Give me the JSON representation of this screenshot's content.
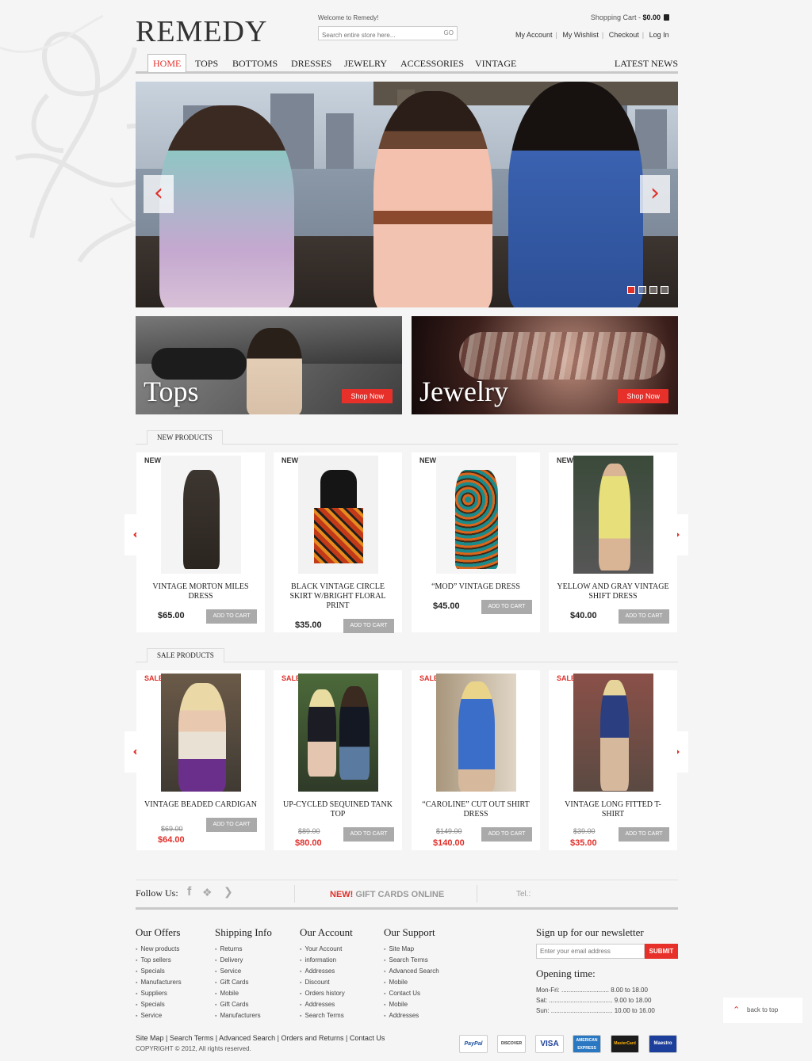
{
  "header": {
    "logo": "REMEDY",
    "welcome": "Welcome to Remedy!",
    "search_placeholder": "Search entire store here...",
    "search_go": "GO",
    "cart_label": "Shopping Cart",
    "cart_sep": " - ",
    "cart_total": "$0.00",
    "links": [
      "My Account",
      "My Wishlist",
      "Checkout",
      "Log In"
    ]
  },
  "nav": {
    "items": [
      "HOME",
      "TOPS",
      "BOTTOMS",
      "DRESSES",
      "JEWELRY",
      "ACCESSORIES",
      "VINTAGE"
    ],
    "right": "LATEST NEWS"
  },
  "hero": {
    "prev": "‹",
    "next": "›",
    "slides": 4,
    "active_slide": 1
  },
  "banners": [
    {
      "title": "Tops",
      "button": "Shop Now"
    },
    {
      "title": "Jewelry",
      "button": "Shop Now"
    }
  ],
  "new_products": {
    "heading": "NEW PRODUCTS",
    "badge": "NEW",
    "add_label": "ADD TO CART",
    "items": [
      {
        "name": "VINTAGE MORTON MILES DRESS",
        "price": "$65.00"
      },
      {
        "name": "BLACK VINTAGE CIRCLE SKIRT W/BRIGHT FLORAL PRINT",
        "price": "$35.00"
      },
      {
        "name": "“MOD” VINTAGE DRESS",
        "price": "$45.00"
      },
      {
        "name": "YELLOW AND GRAY VINTAGE SHIFT DRESS",
        "price": "$40.00"
      }
    ]
  },
  "sale_products": {
    "heading": "SALE PRODUCTS",
    "badge": "SALE",
    "add_label": "ADD TO CART",
    "items": [
      {
        "name": "VINTAGE BEADED CARDIGAN",
        "old_price": "$69.00",
        "price": "$64.00"
      },
      {
        "name": "UP-CYCLED SEQUINED TANK TOP",
        "old_price": "$89.00",
        "price": "$80.00"
      },
      {
        "name": "“CAROLINE” CUT OUT SHIRT DRESS",
        "old_price": "$149.00",
        "price": "$140.00"
      },
      {
        "name": "VINTAGE LONG FITTED T-SHIRT",
        "old_price": "$39.00",
        "price": "$35.00"
      }
    ]
  },
  "follow": {
    "label": "Follow Us:",
    "gift_new": "NEW!",
    "gift_text": " GIFT CARDS ONLINE",
    "tel": "Tel.:"
  },
  "footer": {
    "columns": [
      {
        "title": "Our Offers",
        "items": [
          "New products",
          "Top sellers",
          "Specials",
          "Manufacturers",
          "Suppliers",
          "Specials",
          "Service"
        ]
      },
      {
        "title": "Shipping Info",
        "items": [
          "Returns",
          "Delivery",
          "Service",
          "Gift Cards",
          "Mobile",
          "Gift Cards",
          "Manufacturers"
        ]
      },
      {
        "title": "Our Account",
        "items": [
          "Your Account",
          "information",
          "Addresses",
          "Discount",
          "Orders history",
          "Addresses",
          "Search Terms"
        ]
      },
      {
        "title": "Our Support",
        "items": [
          "Site Map",
          "Search Terms",
          "Advanced Search",
          "Mobile",
          "Contact Us",
          "Mobile",
          "Addresses"
        ]
      }
    ],
    "newsletter_title": "Sign up for our newsletter",
    "newsletter_placeholder": "Enter your email address",
    "submit": "SUBMIT",
    "opening_title": "Opening time:",
    "hours": [
      {
        "day": "Mon-Fri:",
        "dots": " ...........................",
        "time": " 8.00 to 18.00"
      },
      {
        "day": "Sat:",
        "dots": " ....................................",
        "time": " 9.00 to 18.00"
      },
      {
        "day": "Sun:",
        "dots": " ...................................",
        "time": " 10.00 to 16.00"
      }
    ],
    "bottom_links": [
      "Site Map",
      "Search Terms",
      "Advanced Search",
      "Orders and Returns",
      "Contact Us"
    ],
    "copyright": "COPYRIGHT © 2012, All rights reserved.",
    "back_to_top": "back to top",
    "payments": [
      "PayPal",
      "DISCOVER",
      "VISA",
      "AMERICAN EXPRESS",
      "MasterCard",
      "Maestro"
    ]
  },
  "colors": {
    "accent": "#e0302a",
    "background": "#f5f5f5"
  }
}
